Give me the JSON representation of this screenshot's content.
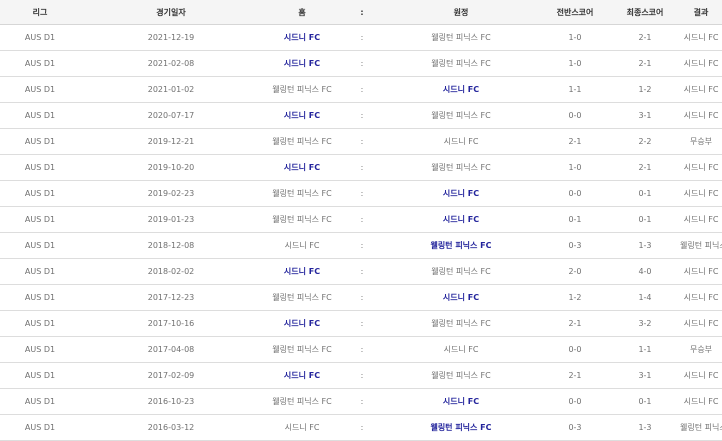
{
  "headers": {
    "league": "리그",
    "date": "경기일자",
    "home": "홈",
    "sep": ":",
    "away": "원정",
    "half_score": "전반스코어",
    "final_score": "최종스코어",
    "result": "결과"
  },
  "rows": [
    {
      "league": "AUS D1",
      "date": "2021-12-19",
      "home": "시드니 FC",
      "home_win": true,
      "sep": ":",
      "away": "웰링턴 피닉스 FC",
      "away_win": false,
      "half": "1-0",
      "final": "2-1",
      "result": "시드니 FC"
    },
    {
      "league": "AUS D1",
      "date": "2021-02-08",
      "home": "시드니 FC",
      "home_win": true,
      "sep": ":",
      "away": "웰링턴 피닉스 FC",
      "away_win": false,
      "half": "1-0",
      "final": "2-1",
      "result": "시드니 FC"
    },
    {
      "league": "AUS D1",
      "date": "2021-01-02",
      "home": "웰링턴 피닉스 FC",
      "home_win": false,
      "sep": ":",
      "away": "시드니 FC",
      "away_win": true,
      "half": "1-1",
      "final": "1-2",
      "result": "시드니 FC"
    },
    {
      "league": "AUS D1",
      "date": "2020-07-17",
      "home": "시드니 FC",
      "home_win": true,
      "sep": ":",
      "away": "웰링턴 피닉스 FC",
      "away_win": false,
      "half": "0-0",
      "final": "3-1",
      "result": "시드니 FC"
    },
    {
      "league": "AUS D1",
      "date": "2019-12-21",
      "home": "웰링턴 피닉스 FC",
      "home_win": false,
      "sep": ":",
      "away": "시드니 FC",
      "away_win": false,
      "half": "2-1",
      "final": "2-2",
      "result": "무승부"
    },
    {
      "league": "AUS D1",
      "date": "2019-10-20",
      "home": "시드니 FC",
      "home_win": true,
      "sep": ":",
      "away": "웰링턴 피닉스 FC",
      "away_win": false,
      "half": "1-0",
      "final": "2-1",
      "result": "시드니 FC"
    },
    {
      "league": "AUS D1",
      "date": "2019-02-23",
      "home": "웰링턴 피닉스 FC",
      "home_win": false,
      "sep": ":",
      "away": "시드니 FC",
      "away_win": true,
      "half": "0-0",
      "final": "0-1",
      "result": "시드니 FC"
    },
    {
      "league": "AUS D1",
      "date": "2019-01-23",
      "home": "웰링턴 피닉스 FC",
      "home_win": false,
      "sep": ":",
      "away": "시드니 FC",
      "away_win": true,
      "half": "0-1",
      "final": "0-1",
      "result": "시드니 FC"
    },
    {
      "league": "AUS D1",
      "date": "2018-12-08",
      "home": "시드니 FC",
      "home_win": false,
      "sep": ":",
      "away": "웰링턴 피닉스 FC",
      "away_win": true,
      "half": "0-3",
      "final": "1-3",
      "result": "웰링턴 피닉스 FC"
    },
    {
      "league": "AUS D1",
      "date": "2018-02-02",
      "home": "시드니 FC",
      "home_win": true,
      "sep": ":",
      "away": "웰링턴 피닉스 FC",
      "away_win": false,
      "half": "2-0",
      "final": "4-0",
      "result": "시드니 FC"
    },
    {
      "league": "AUS D1",
      "date": "2017-12-23",
      "home": "웰링턴 피닉스 FC",
      "home_win": false,
      "sep": ":",
      "away": "시드니 FC",
      "away_win": true,
      "half": "1-2",
      "final": "1-4",
      "result": "시드니 FC"
    },
    {
      "league": "AUS D1",
      "date": "2017-10-16",
      "home": "시드니 FC",
      "home_win": true,
      "sep": ":",
      "away": "웰링턴 피닉스 FC",
      "away_win": false,
      "half": "2-1",
      "final": "3-2",
      "result": "시드니 FC"
    },
    {
      "league": "AUS D1",
      "date": "2017-04-08",
      "home": "웰링턴 피닉스 FC",
      "home_win": false,
      "sep": ":",
      "away": "시드니 FC",
      "away_win": false,
      "half": "0-0",
      "final": "1-1",
      "result": "무승부"
    },
    {
      "league": "AUS D1",
      "date": "2017-02-09",
      "home": "시드니 FC",
      "home_win": true,
      "sep": ":",
      "away": "웰링턴 피닉스 FC",
      "away_win": false,
      "half": "2-1",
      "final": "3-1",
      "result": "시드니 FC"
    },
    {
      "league": "AUS D1",
      "date": "2016-10-23",
      "home": "웰링턴 피닉스 FC",
      "home_win": false,
      "sep": ":",
      "away": "시드니 FC",
      "away_win": true,
      "half": "0-0",
      "final": "0-1",
      "result": "시드니 FC"
    },
    {
      "league": "AUS D1",
      "date": "2016-03-12",
      "home": "시드니 FC",
      "home_win": false,
      "sep": ":",
      "away": "웰링턴 피닉스 FC",
      "away_win": true,
      "half": "0-3",
      "final": "1-3",
      "result": "웰링턴 피닉스 FC"
    }
  ],
  "colors": {
    "winner_text": "#23249c",
    "normal_text": "#707070",
    "header_bg": "#f5f5f5",
    "row_border": "#dddddd"
  }
}
